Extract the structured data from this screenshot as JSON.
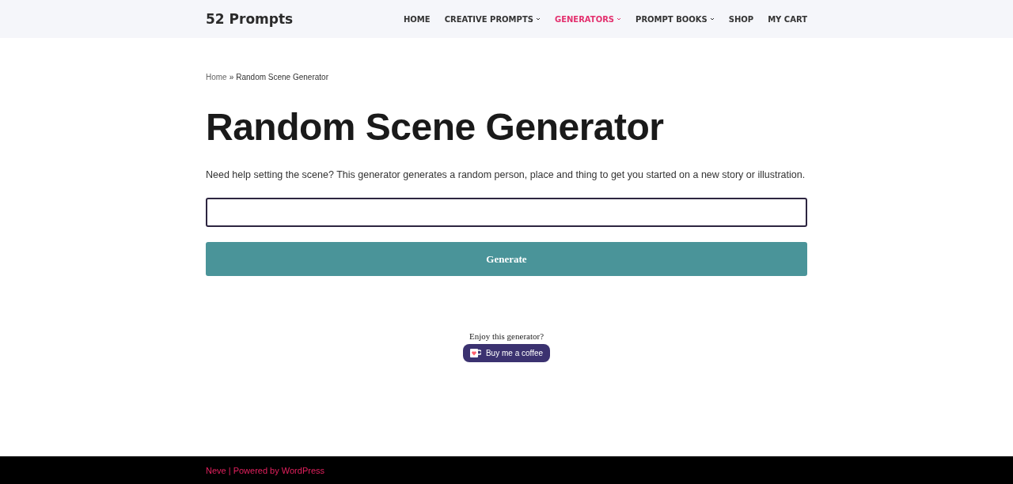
{
  "header": {
    "logo": "52 Prompts",
    "nav": [
      {
        "label": "HOME",
        "dropdown": false,
        "selected": false
      },
      {
        "label": "CREATIVE PROMPTS",
        "dropdown": true,
        "selected": false
      },
      {
        "label": "GENERATORS",
        "dropdown": true,
        "selected": true
      },
      {
        "label": "PROMPT BOOKS",
        "dropdown": true,
        "selected": false
      },
      {
        "label": "SHOP",
        "dropdown": false,
        "selected": false
      },
      {
        "label": "MY CART",
        "dropdown": false,
        "selected": false
      }
    ]
  },
  "breadcrumb": {
    "home": "Home",
    "separator": "»",
    "current": "Random Scene Generator"
  },
  "title": "Random Scene Generator",
  "intro": "Need help setting the scene? This generator generates a random person, place and thing to get you started on a new story or illustration.",
  "generate_button": "Generate",
  "support": {
    "prompt": "Enjoy this generator?",
    "button": "Buy me a coffee"
  },
  "footer": "Neve | Powered by WordPress"
}
